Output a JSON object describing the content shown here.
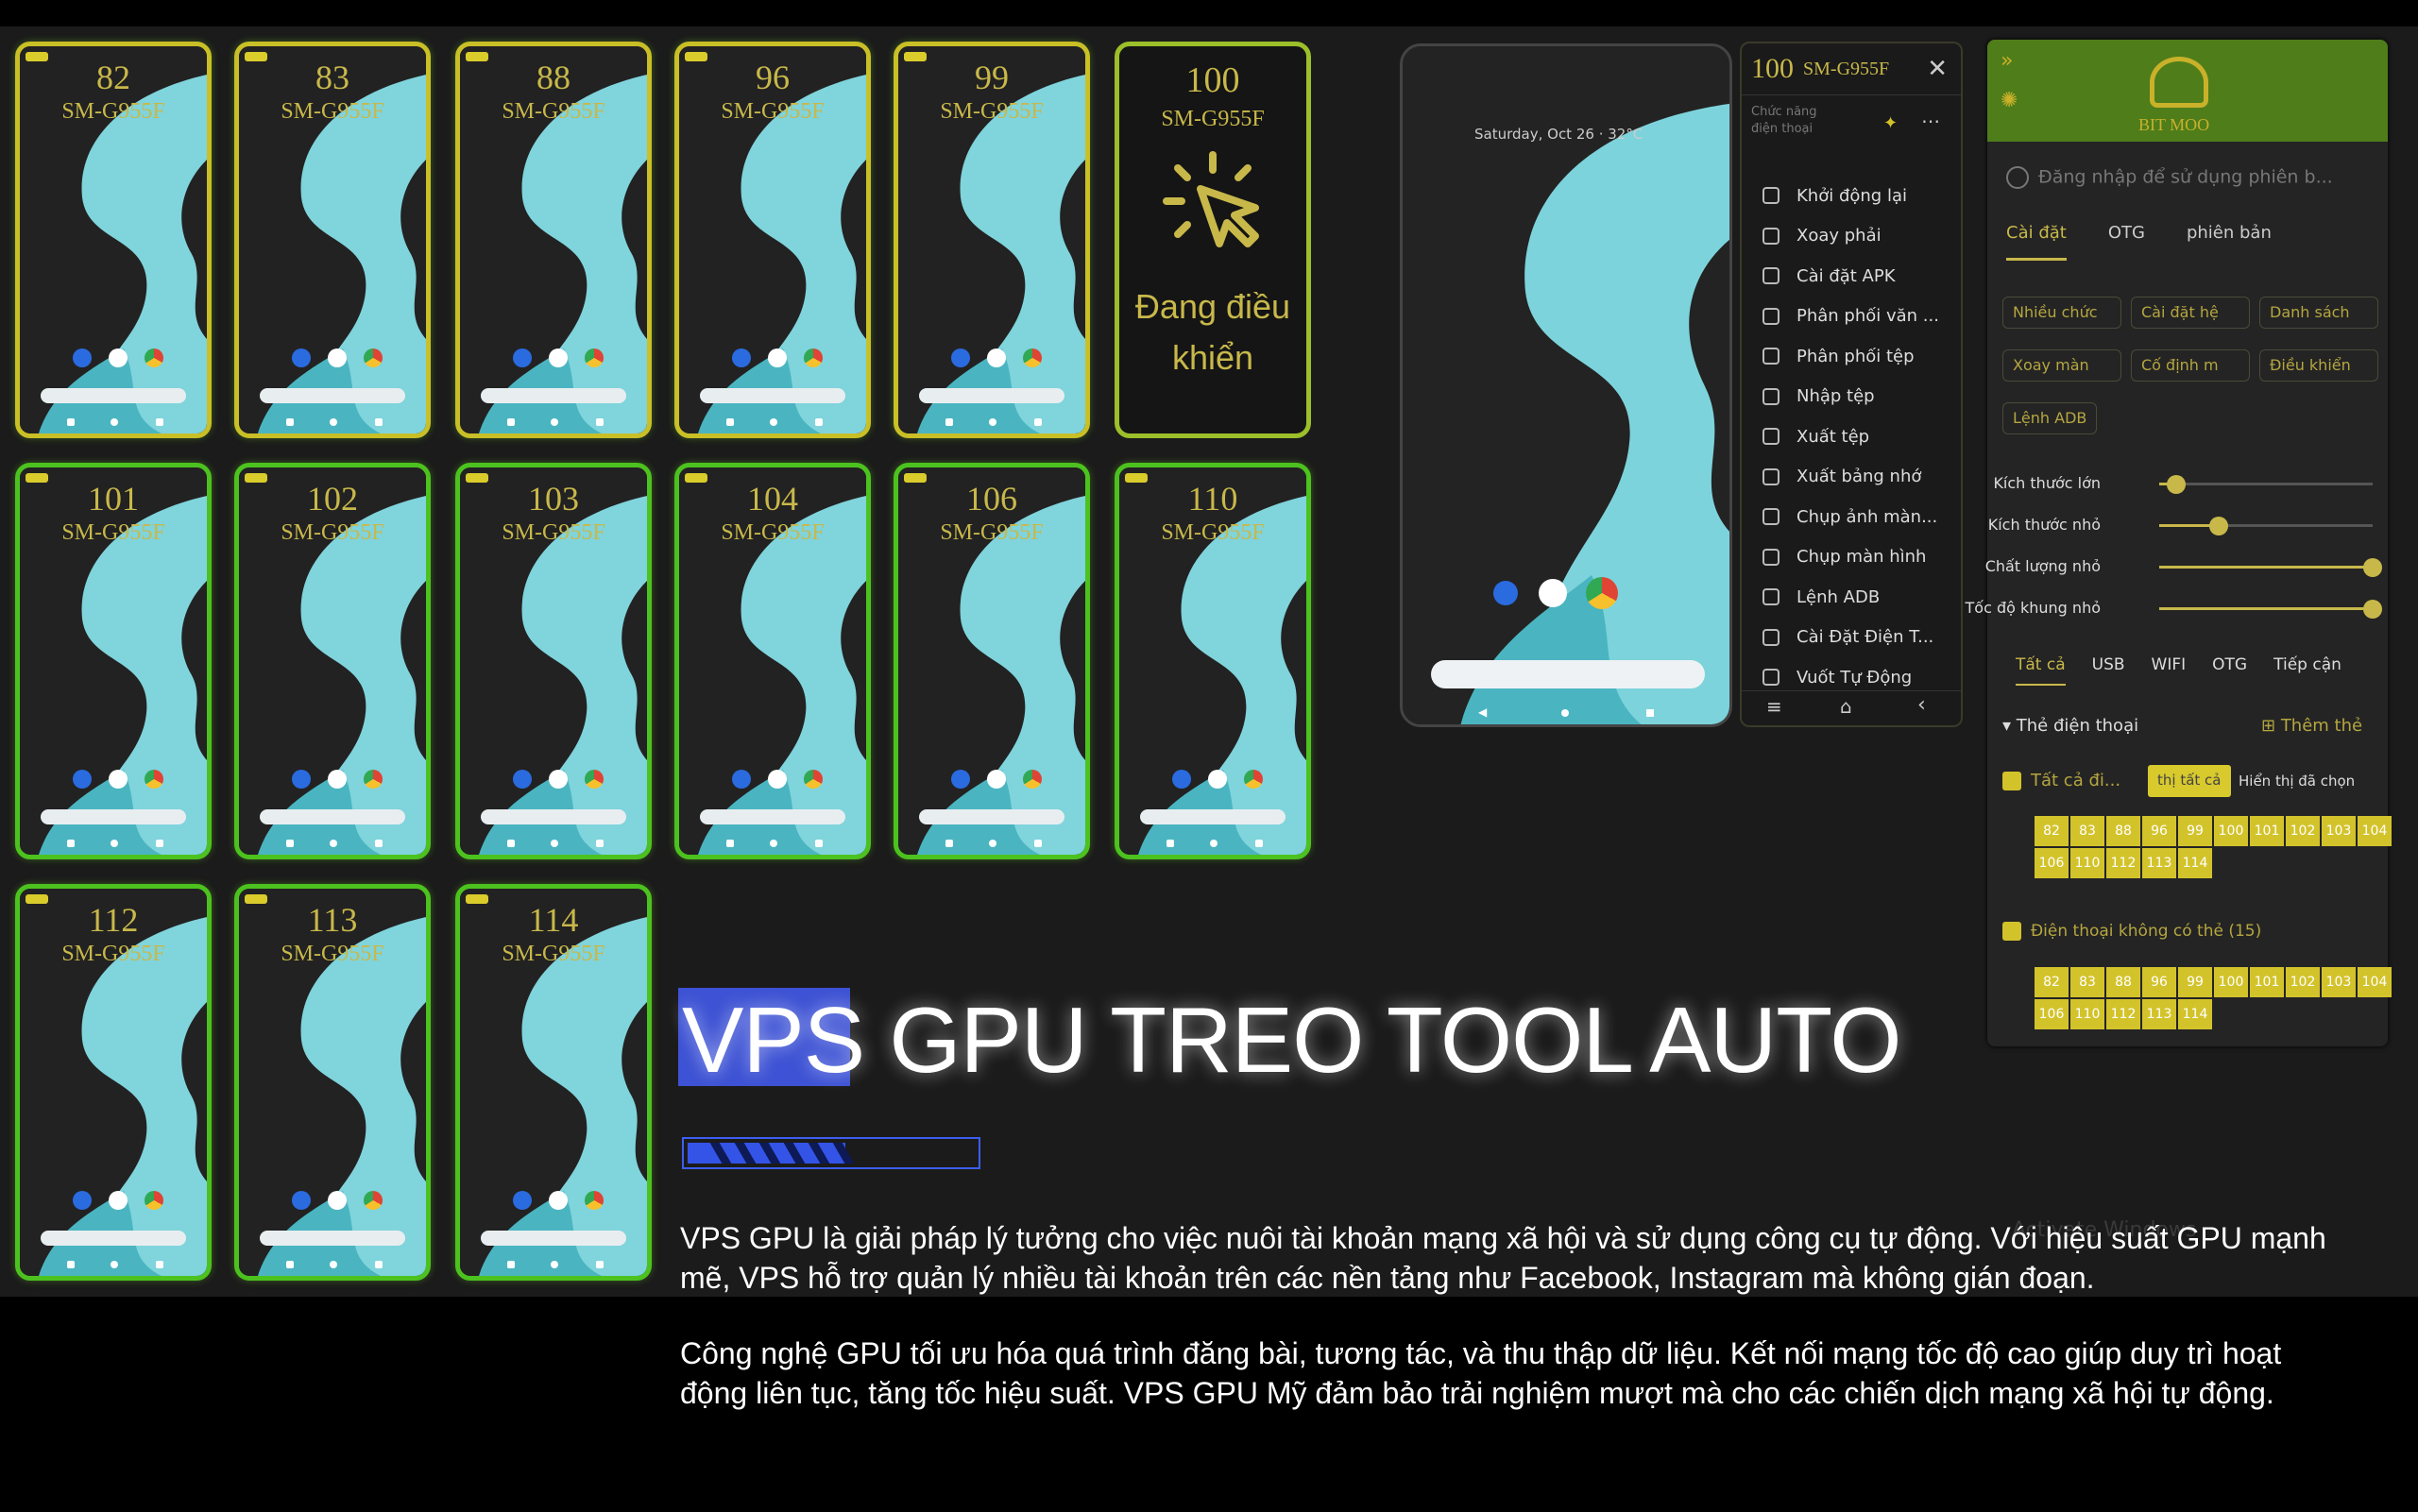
{
  "tiles": [
    {
      "num": "82",
      "model": "SM-G955F"
    },
    {
      "num": "83",
      "model": "SM-G955F"
    },
    {
      "num": "88",
      "model": "SM-G955F"
    },
    {
      "num": "96",
      "model": "SM-G955F"
    },
    {
      "num": "99",
      "model": "SM-G955F"
    },
    {
      "num": "101",
      "model": "SM-G955F"
    },
    {
      "num": "102",
      "model": "SM-G955F"
    },
    {
      "num": "103",
      "model": "SM-G955F"
    },
    {
      "num": "104",
      "model": "SM-G955F"
    },
    {
      "num": "106",
      "model": "SM-G955F"
    },
    {
      "num": "110",
      "model": "SM-G955F"
    },
    {
      "num": "112",
      "model": "SM-G955F"
    },
    {
      "num": "113",
      "model": "SM-G955F"
    },
    {
      "num": "114",
      "model": "SM-G955F"
    }
  ],
  "control_tile": {
    "num": "100",
    "model": "SM-G955F",
    "label": "Đang điều khiển"
  },
  "big_phone": {
    "date": "Saturday, Oct 26 · 32°C"
  },
  "menu": {
    "head_num": "100",
    "head_model": "SM-G955F",
    "sub": "Chức năng điện thoại",
    "items": [
      "Khởi động lại",
      "Xoay phải",
      "Cài đặt APK",
      "Phân phối văn ...",
      "Phân phối tệp",
      "Nhập tệp",
      "Xuất tệp",
      "Xuất bảng nhớ",
      "Chụp ảnh màn...",
      "Chụp màn hình",
      "Lệnh ADB",
      "Cài Đặt Điện T...",
      "Vuốt Tự Động"
    ]
  },
  "panel": {
    "logo_text": "BIT MOO",
    "login": "Đăng nhập để sử dụng phiên b...",
    "tabs": [
      "Cài đặt",
      "OTG",
      "phiên bản"
    ],
    "chips": [
      "Nhiều chức",
      "Cài đặt hệ",
      "Danh sách",
      "Xoay màn",
      "Cố định m",
      "Điều khiển",
      "Lệnh ADB"
    ],
    "sliders": [
      {
        "label": "Kích thước lớn",
        "value": 0.08
      },
      {
        "label": "Kích thước nhỏ",
        "value": 0.28
      },
      {
        "label": "Chất lượng nhỏ",
        "value": 1.0
      },
      {
        "label": "Tốc độ khung nhỏ",
        "value": 1.0
      }
    ],
    "conn_tabs": [
      "Tất cả",
      "USB",
      "WIFI",
      "OTG",
      "Tiếp cận"
    ],
    "group_title": "Thẻ điện thoại",
    "add_tag": "Thêm thẻ",
    "all_label": "Tất cả đi...",
    "show_all": "thị tất cả",
    "show_selected": "Hiển thị đã chọn",
    "numbers": [
      "82",
      "83",
      "88",
      "96",
      "99",
      "100",
      "101",
      "102",
      "103",
      "104",
      "106",
      "110",
      "112",
      "113",
      "114"
    ],
    "untagged": "Điện thoại không có thẻ (15)",
    "numbers2": [
      "82",
      "83",
      "88",
      "96",
      "99",
      "100",
      "101",
      "102",
      "103",
      "104",
      "106",
      "110",
      "112",
      "113",
      "114"
    ]
  },
  "watermark": "Activate Windows",
  "headline": "VPS GPU TREO TOOL AUTO",
  "progress": 0.55,
  "paragraphs": [
    "VPS GPU là giải pháp lý tưởng cho việc nuôi tài khoản mạng xã hội và sử dụng công cụ tự động. Với hiệu suất GPU mạnh mẽ, VPS hỗ trợ quản lý nhiều tài khoản trên các nền tảng như Facebook, Instagram mà không gián đoạn.",
    "Công nghệ GPU tối ưu hóa quá trình đăng bài, tương tác, và thu thập dữ liệu. Kết nối mạng tốc độ cao giúp duy trì hoạt động liên tục, tăng tốc hiệu suất. VPS GPU Mỹ đảm bảo trải nghiệm mượt mà cho các chiến dịch mạng xã hội tự động."
  ]
}
